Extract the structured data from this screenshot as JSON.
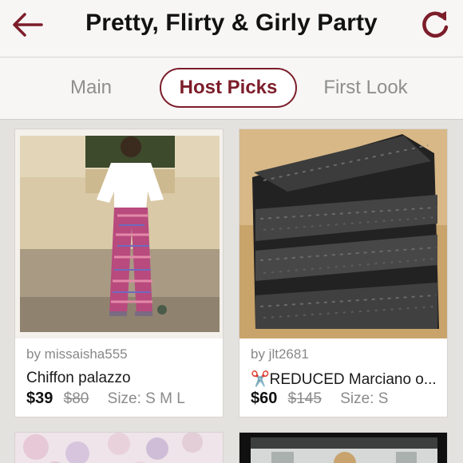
{
  "header": {
    "title": "Pretty, Flirty & Girly Party",
    "back_icon": "back-arrow-icon",
    "refresh_icon": "refresh-icon",
    "accent_color": "#7c1d2a"
  },
  "tabs": [
    {
      "label": "Main",
      "active": false
    },
    {
      "label": "Host Picks",
      "active": true
    },
    {
      "label": "First Look",
      "active": false
    }
  ],
  "listings": [
    {
      "byline": "by missaisha555",
      "title": "Chiffon palazzo",
      "price": "$39",
      "original_price": "$80",
      "size": "Size: S M L"
    },
    {
      "byline": "by jlt2681",
      "title": "✂️REDUCED Marciano o...",
      "price": "$60",
      "original_price": "$145",
      "size": "Size: S"
    }
  ]
}
